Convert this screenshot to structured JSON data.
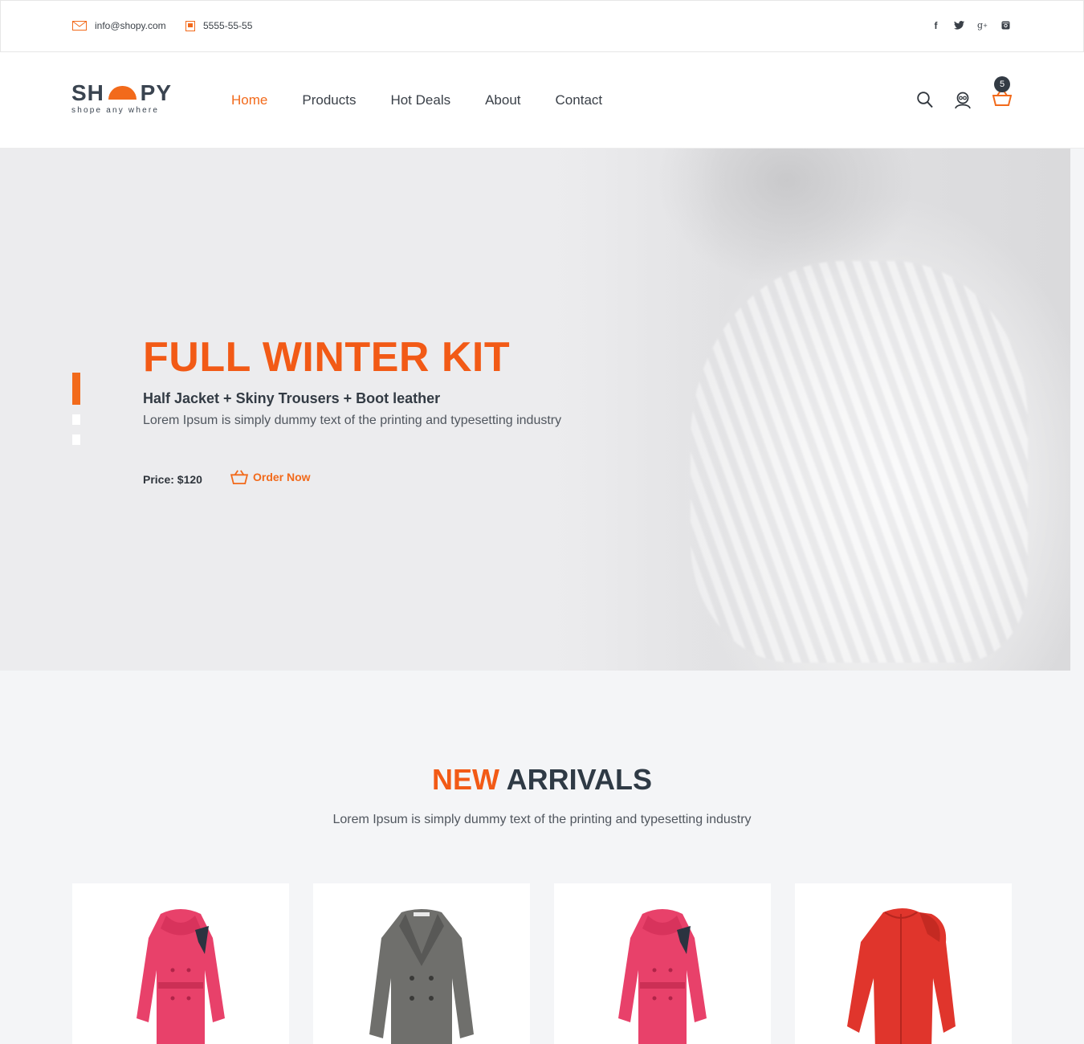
{
  "topbar": {
    "email": "info@shopy.com",
    "phone": "5555-55-55",
    "social": [
      "facebook-icon",
      "twitter-icon",
      "google-plus-icon",
      "instagram-icon"
    ]
  },
  "header": {
    "logo_left": "SH",
    "logo_right": "PY",
    "logo_tagline": "shope any where",
    "nav": [
      {
        "label": "Home",
        "active": true
      },
      {
        "label": "Products",
        "active": false
      },
      {
        "label": "Hot Deals",
        "active": false
      },
      {
        "label": "About",
        "active": false
      },
      {
        "label": "Contact",
        "active": false
      }
    ],
    "cart_count": "5"
  },
  "hero": {
    "title": "FULL WINTER KIT",
    "subtitle": "Half Jacket + Skiny Trousers + Boot leather",
    "description": "Lorem Ipsum is simply dummy text of the printing and typesetting industry",
    "price": "Price: $120",
    "order_label": "Order Now",
    "slides": 3,
    "active_slide": 1
  },
  "arrivals": {
    "title_accent": "NEW",
    "title_rest": "ARRIVALS",
    "subtitle": "Lorem Ipsum is simply dummy text of the printing and typesetting industry",
    "products": [
      {
        "image": "pink-coat",
        "color": "#e8416a"
      },
      {
        "image": "grey-coat",
        "color": "#6d6d6b"
      },
      {
        "image": "pink-coat",
        "color": "#e8416a"
      },
      {
        "image": "red-hoodie",
        "color": "#e0352c"
      }
    ]
  },
  "colors": {
    "accent": "#f26a1b",
    "dark": "#333b44"
  }
}
